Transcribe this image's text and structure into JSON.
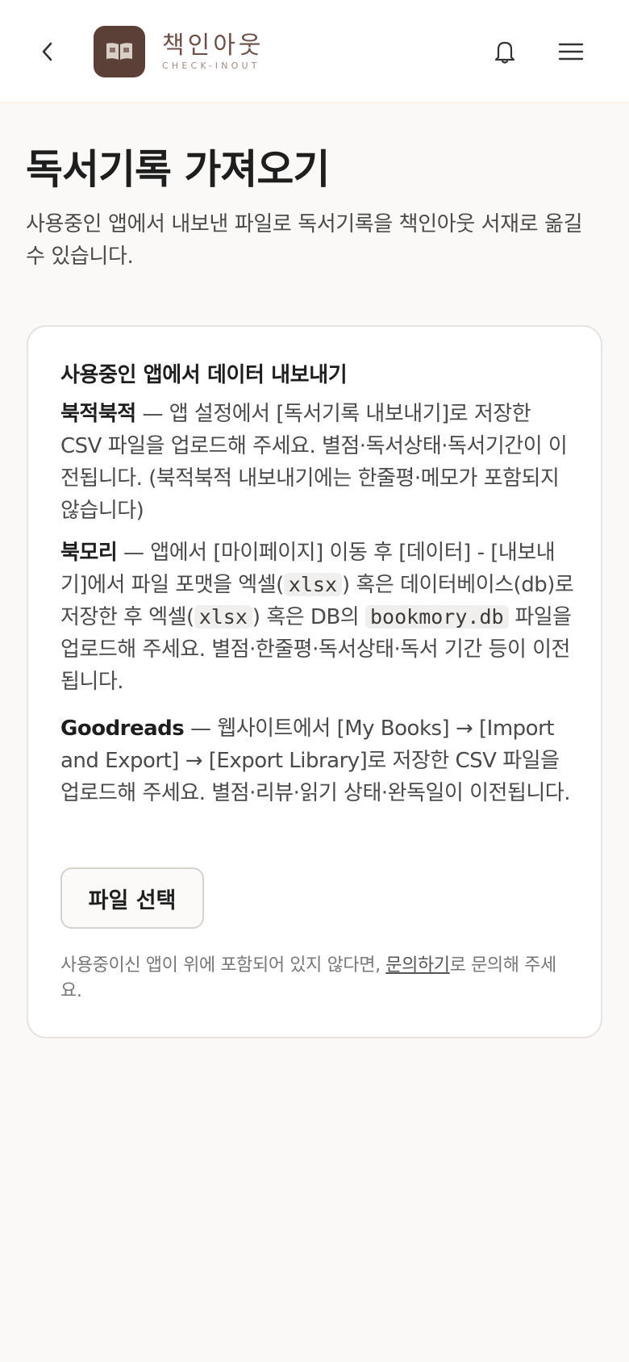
{
  "header": {
    "logo_ko": "책인아웃",
    "logo_en": "CHECK-INOUT",
    "back_icon": "chevron-left-icon",
    "notification_icon": "bell-icon",
    "menu_icon": "hamburger-icon",
    "brand_color": "#5b4037"
  },
  "page": {
    "title": "독서기록 가져오기",
    "description": "사용중인 앱에서 내보낸 파일로 독서기록을 책인아웃 서재로 옮길 수 있습니다."
  },
  "card": {
    "heading": "사용중인 앱에서 데이터 내보내기",
    "bukjeok": {
      "name": "북적북적",
      "text": " — 앱 설정에서 [독서기록 내보내기]로 저장한 CSV 파일을 업로드해 주세요. 별점·독서상태·독서기간이 이전됩니다. (북적북적 내보내기에는 한줄평·메모가 포함되지 않습니다)"
    },
    "bookmory": {
      "name": "북모리",
      "text_1": " — 앱에서 [마이페이지] 이동 후 [데이터] - [내보내기]에서 파일 포맷을 엑셀(",
      "code_1": "xlsx",
      "text_2": ") 혹은 데이터베이스(db)로 저장한 후 엑셀(",
      "code_2": "xlsx",
      "text_3": ") 혹은 DB의 ",
      "code_3": "bookmory.db",
      "text_4": " 파일을 업로드해 주세요. 별점·한줄평·독서상태·독서 기간 등이 이전됩니다."
    },
    "goodreads": {
      "name": "Goodreads",
      "text": " — 웹사이트에서 [My Books] → [Import and Export] → [Export Library]로 저장한 CSV 파일을 업로드해 주세요. 별점·리뷰·읽기 상태·완독일이 이전됩니다."
    },
    "file_button_label": "파일 선택",
    "footer": {
      "text_before": "사용중이신 앱이 위에 포함되어 있지 않다면, ",
      "link": "문의하기",
      "text_after": "로 문의해 주세요."
    }
  }
}
